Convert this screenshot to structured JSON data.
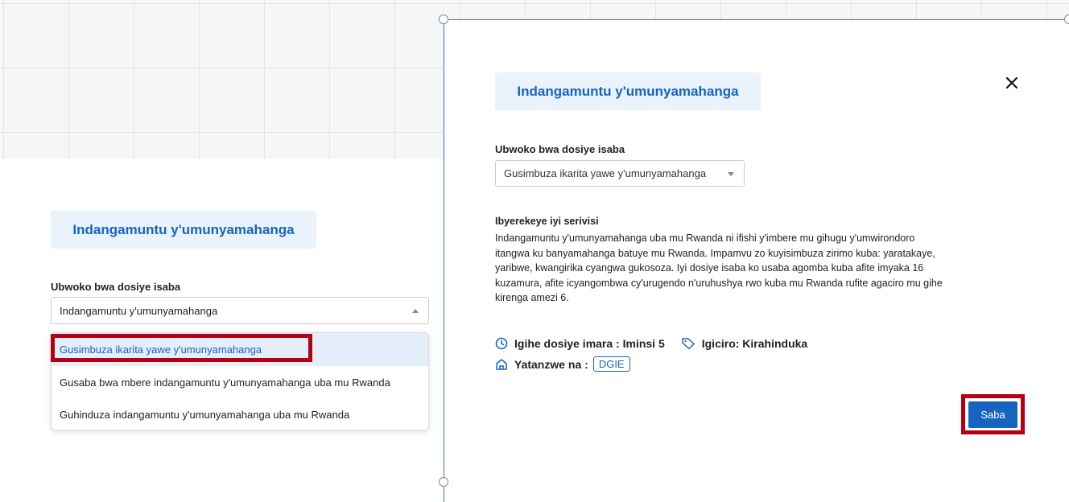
{
  "left": {
    "title": "Indangamuntu y'umunyamahanga",
    "field_label": "Ubwoko bwa dosiye isaba",
    "select_value": "Indangamuntu y'umunyamahanga",
    "options": [
      "Gusimbuza ikarita yawe y'umunyamahanga",
      "Gusaba bwa mbere indangamuntu y'umunyamahanga uba mu Rwanda",
      "Guhinduza indangamuntu y'umunyamahanga uba mu Rwanda"
    ]
  },
  "modal": {
    "title": "Indangamuntu y'umunyamahanga",
    "close_icon": "close-icon",
    "field_label": "Ubwoko bwa dosiye isaba",
    "select_value": "Gusimbuza ikarita yawe y'umunyamahanga",
    "info_heading": "Ibyerekeye iyi serivisi",
    "info_lines": [
      "Indangamuntu y'umunyamahanga uba mu Rwanda ni ifishi y'imbere mu gihugu y'umwirondoro",
      "itangwa ku banyamahanga batuye mu Rwanda. Impamvu zo kuyisimbuza zirimo kuba: yaratakaye,",
      "yaribwe, kwangirika cyangwa gukosoza. Iyi dosiye isaba ko usaba agomba kuba afite imyaka 16",
      "kuzamura, afite icyangombwa cy'urugendo n'uruhushya rwo kuba mu Rwanda rufite agaciro mu gihe",
      "kirenga amezi 6."
    ],
    "time_label": "Igihe dosiye imara : Iminsi 5",
    "price_label": "Igiciro: Kirahinduka",
    "provider_label": "Yatanzwe na :",
    "provider_badge": "DGIE",
    "submit_label": "Saba"
  },
  "colors": {
    "accent": "#1565c0",
    "highlight": "#b30012",
    "title_bg": "#eaf2fb"
  }
}
